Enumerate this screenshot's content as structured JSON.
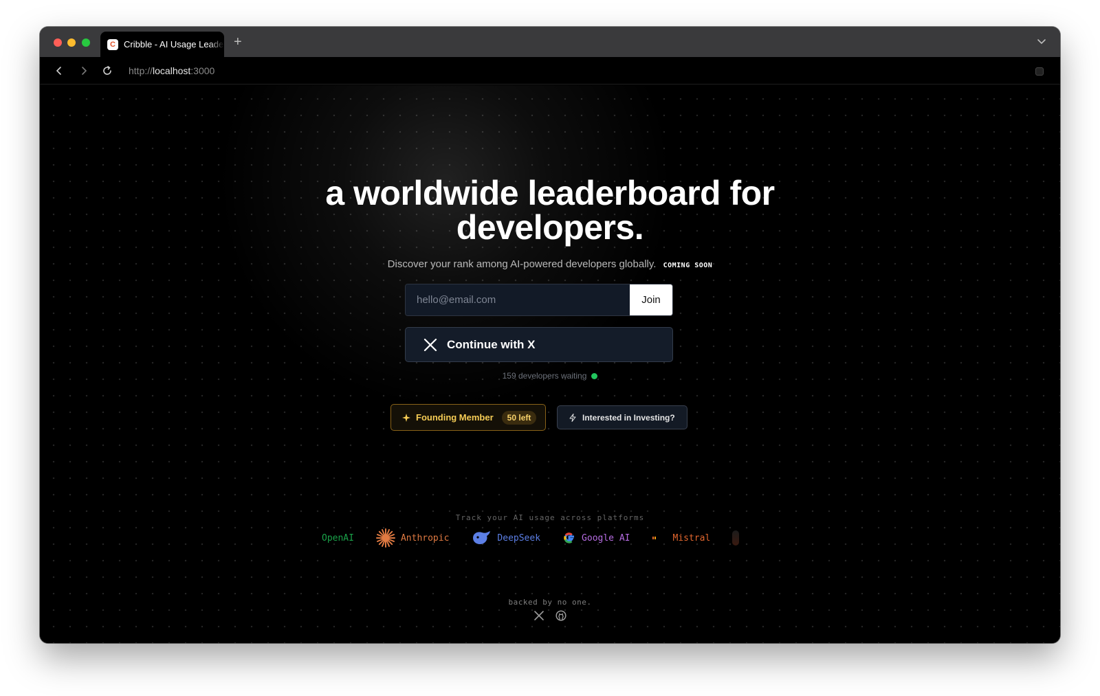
{
  "browser": {
    "tab_title": "Cribble - AI Usage Leaderboard",
    "favicon_letter": "C",
    "new_tab": "+",
    "url_scheme": "http://",
    "url_host": "localhost",
    "url_port": ":3000"
  },
  "hero": {
    "headline_line1": "a worldwide leaderboard for",
    "headline_line2": "developers.",
    "subtitle": "Discover your rank among AI-powered developers globally.",
    "coming_soon": "COMING SOON"
  },
  "signup": {
    "email_placeholder": "hello@email.com",
    "join_label": "Join",
    "x_label": "Continue with X",
    "waiting_text": "159 developers waiting"
  },
  "badges": {
    "founding_label": "Founding Member",
    "founding_remaining": "50 left",
    "investing_label": "Interested in Investing?"
  },
  "platforms": {
    "heading": "Track your AI usage across platforms",
    "items": [
      "OpenAI",
      "Anthropic",
      "DeepSeek",
      "Google AI",
      "Mistral"
    ]
  },
  "footer": {
    "tagline": "backed by no one."
  },
  "colors": {
    "background": "#000000",
    "founding_gold": "#f5cc55",
    "status_green": "#22c55e",
    "openai": "#1aa34a",
    "anthropic": "#e07a42",
    "deepseek": "#5c7fe6",
    "google": "#b76de3",
    "mistral": "#e2662e"
  }
}
